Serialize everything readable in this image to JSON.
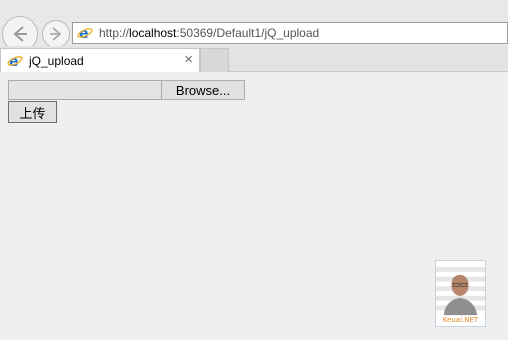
{
  "browser": {
    "address": {
      "url_prefix": "http://",
      "url_host": "localhost",
      "url_rest": ":50369/Default1/jQ_upload"
    },
    "tab": {
      "title": "jQ_upload",
      "close_glyph": "×"
    },
    "icons": {
      "back": "back-arrow-icon",
      "forward": "forward-arrow-icon",
      "ie": "internet-explorer-icon"
    }
  },
  "page": {
    "file_input": {
      "path_value": "",
      "browse_label": "Browse..."
    },
    "upload_button_label": "上传"
  },
  "avatar_widget": {
    "caption": "Keuai.NET"
  },
  "colors": {
    "ie_blue": "#1e6fd0",
    "ie_ring": "#f2b01e",
    "caption_orange": "#e38b2a"
  }
}
